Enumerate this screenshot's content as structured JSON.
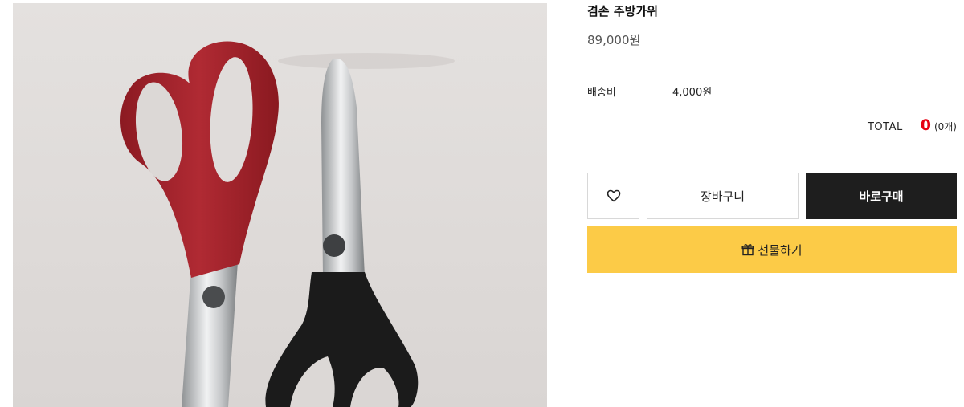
{
  "product": {
    "name": "겸손 주방가위",
    "price": "89,000원",
    "image_icon": "kitchen-scissors-photo"
  },
  "shipping": {
    "label": "배송비",
    "value": "4,000원"
  },
  "total": {
    "label": "TOTAL",
    "amount": "0",
    "count": "(0개)",
    "amount_color": "#e60012"
  },
  "buttons": {
    "wishlist_icon": "heart-icon",
    "cart_label": "장바구니",
    "buy_label": "바로구매",
    "gift_icon": "gift-icon",
    "gift_label": "선물하기"
  },
  "colors": {
    "buy_bg": "#1e1e1e",
    "gift_bg": "#fccb47",
    "scissors_red": "#a3222b",
    "scissors_black": "#1b1b1b"
  }
}
